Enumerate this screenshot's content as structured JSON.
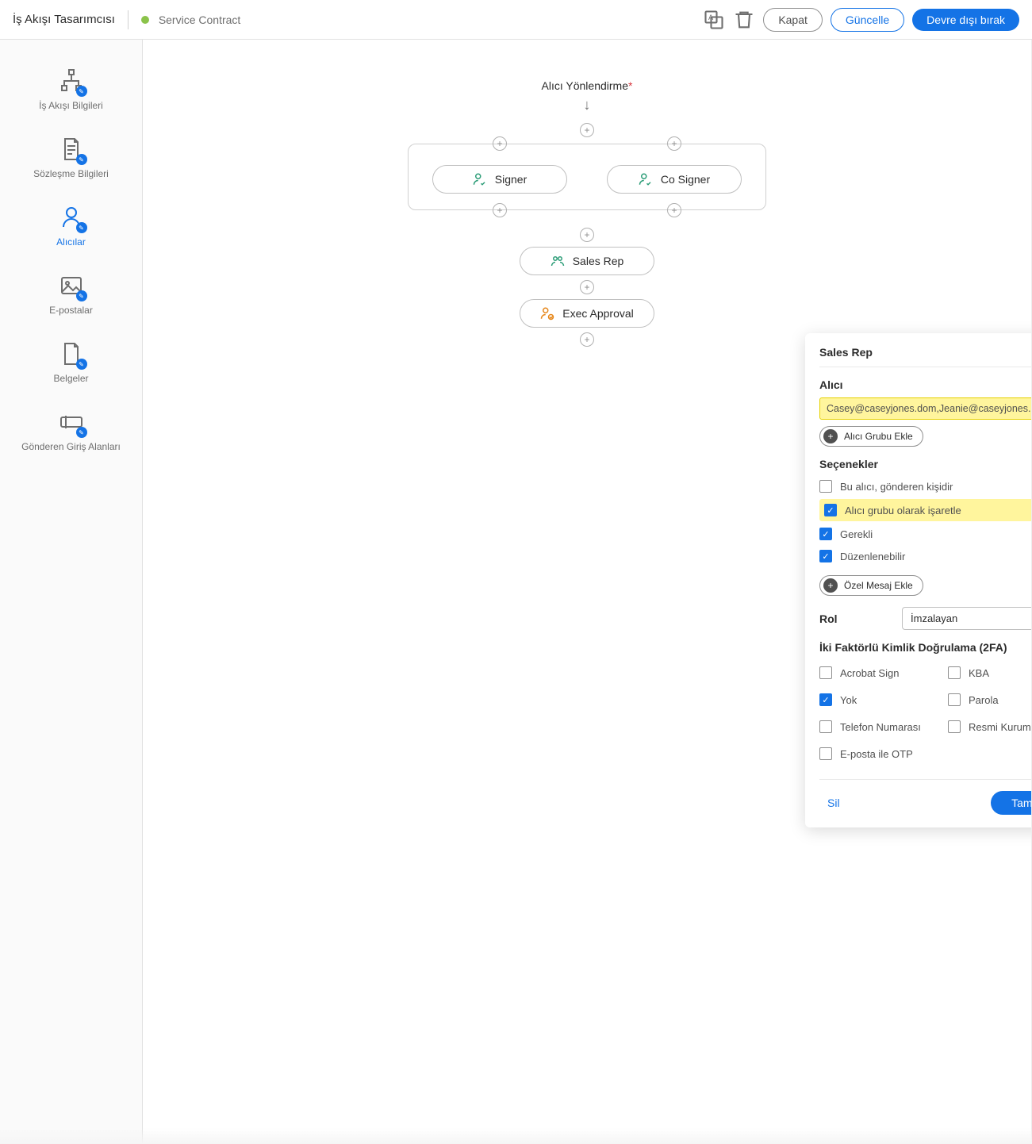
{
  "header": {
    "title": "İş Akışı Tasarımcısı",
    "contract_name": "Service Contract",
    "close_label": "Kapat",
    "update_label": "Güncelle",
    "disable_label": "Devre dışı bırak"
  },
  "sidebar": {
    "items": [
      {
        "label": "İş Akışı Bilgileri"
      },
      {
        "label": "Sözleşme Bilgileri"
      },
      {
        "label": "Alıcılar"
      },
      {
        "label": "E-postalar"
      },
      {
        "label": "Belgeler"
      },
      {
        "label": "Gönderen Giriş Alanları"
      }
    ]
  },
  "flow": {
    "title": "Alıcı Yönlendirme",
    "nodes": {
      "signer": "Signer",
      "cosigner": "Co Signer",
      "salesrep": "Sales Rep",
      "exec": "Exec Approval"
    }
  },
  "popup": {
    "title": "Sales Rep",
    "alici_label": "Alıcı",
    "alici_value": "Casey@caseyjones.dom,Jeanie@caseyjones.dom,Ge",
    "add_group_label": "Alıcı Grubu Ekle",
    "options_label": "Seçenekler",
    "options": {
      "sender": {
        "label": "Bu alıcı, gönderen kişidir",
        "checked": false
      },
      "mark_group": {
        "label": "Alıcı grubu olarak işaretle",
        "checked": true
      },
      "required": {
        "label": "Gerekli",
        "checked": true
      },
      "editable": {
        "label": "Düzenlenebilir",
        "checked": true
      }
    },
    "add_msg_label": "Özel Mesaj Ekle",
    "role_label": "Rol",
    "role_value": "İmzalayan",
    "tfa_label": "İki Faktörlü Kimlik Doğrulama (2FA)",
    "tfa": {
      "acrobat": {
        "label": "Acrobat Sign",
        "checked": false
      },
      "kba": {
        "label": "KBA",
        "checked": false
      },
      "none": {
        "label": "Yok",
        "checked": true
      },
      "password": {
        "label": "Parola",
        "checked": false
      },
      "phone": {
        "label": "Telefon Numarası",
        "checked": false
      },
      "govid": {
        "label": "Resmi Kurum Kimliği",
        "checked": false
      },
      "otp": {
        "label": "E-posta ile OTP",
        "checked": false
      }
    },
    "delete_label": "Sil",
    "ok_label": "Tamam"
  }
}
